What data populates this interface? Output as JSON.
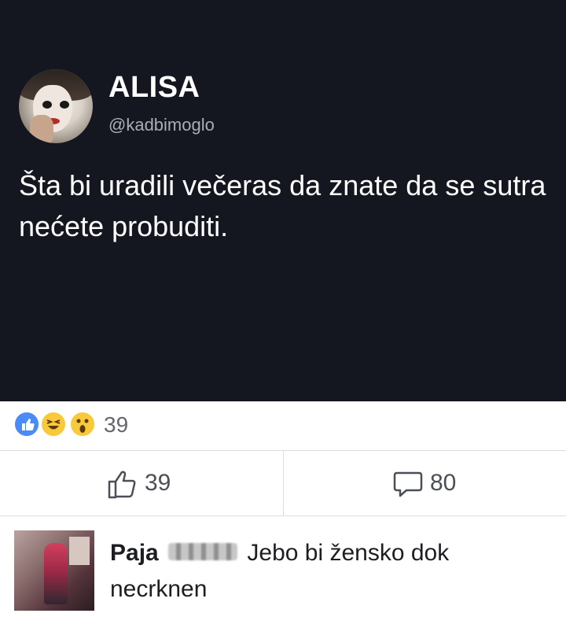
{
  "tweet": {
    "display_name": "ALISA",
    "handle": "@kadbimoglo",
    "text": "Šta bi uradili večeras da znate da se sutra nećete probuditi."
  },
  "reactions": {
    "icons": [
      "like-reaction-icon",
      "haha-reaction-icon",
      "wow-reaction-icon"
    ],
    "count": "39"
  },
  "actions": {
    "like_count": "39",
    "comment_count": "80"
  },
  "comment": {
    "author": "Paja",
    "text": "Jebo bi žensko dok necrknen"
  },
  "colors": {
    "tweet_background": "#14171f",
    "like_blue": "#4b8bf5",
    "reaction_yellow": "#f7c93b",
    "divider": "#dadde1"
  }
}
